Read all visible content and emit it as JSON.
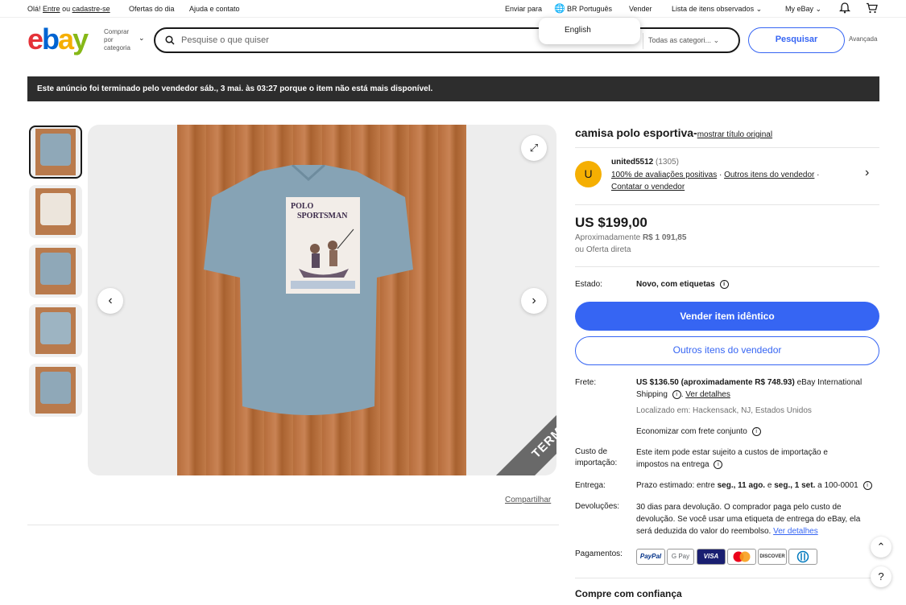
{
  "topbar": {
    "greeting": "Olá!",
    "signin": "Entre",
    "or": "ou",
    "register": "cadastre-se",
    "daily_deals": "Ofertas do dia",
    "help": "Ajuda e contato",
    "ship_to": "Enviar para",
    "language": "BR Português",
    "sell": "Vender",
    "watchlist": "Lista de itens observados",
    "my_ebay": "My eBay",
    "language_option": "English"
  },
  "header": {
    "logo_letters": [
      "e",
      "b",
      "a",
      "y"
    ],
    "logo_colors": [
      "#e53238",
      "#0064d2",
      "#f5af02",
      "#86b817"
    ],
    "shop_by_category": "Comprar por categoria",
    "search_placeholder": "Pesquise o que quiser",
    "category_select": "Todas as categori...",
    "search_button": "Pesquisar",
    "advanced": "Avançada"
  },
  "banner": {
    "text": "Este anúncio foi terminado pelo vendedor sáb., 3 mai. às 03:27 porque o item não está mais disponível."
  },
  "gallery": {
    "ended_ribbon": "TERMINADO",
    "graphic_text_1": "POLO",
    "graphic_text_2": "SPORTSMAN",
    "share": "Compartilhar"
  },
  "item": {
    "title": "camisa polo esportiva-",
    "show_original": "mostrar título original",
    "seller_initial": "U",
    "seller_name": "united5512",
    "seller_score": "(1305)",
    "feedback": "100% de avaliações positivas",
    "other_items_link": "Outros itens do vendedor",
    "contact_seller": "Contatar o vendedor",
    "price": "US $199,00",
    "approx_label": "Aproximadamente",
    "approx_value": "R$ 1 091,85",
    "or_offer": "ou Oferta direta",
    "condition_label": "Estado:",
    "condition_value": "Novo, com etiquetas",
    "sell_similar": "Vender item idêntico",
    "seller_other_items": "Outros itens do vendedor",
    "shipping_label": "Frete:",
    "shipping_value": "US $136.50 (aproximadamente R$ 748.93)",
    "shipping_service": "eBay International Shipping",
    "see_details": "Ver detalhes",
    "located_in": "Localizado em: Hackensack, NJ, Estados Unidos",
    "combined_shipping": "Economizar com frete conjunto",
    "import_label": "Custo de importação:",
    "import_value": "Este item pode estar sujeito a custos de importação e impostos na entrega",
    "delivery_label": "Entrega:",
    "delivery_prefix": "Prazo estimado: entre",
    "delivery_from": "seg., 11 ago.",
    "delivery_and": "e",
    "delivery_to": "seg., 1 set.",
    "delivery_suffix": "a 100-0001",
    "returns_label": "Devoluções:",
    "returns_value": "30 dias para devolução. O comprador paga pelo custo de devolução. Se você usar uma etiqueta de entrega do eBay, ela será deduzida do valor do reembolso.",
    "returns_details": "Ver detalhes",
    "payments_label": "Pagamentos:",
    "payments": [
      "PayPal",
      "G Pay",
      "VISA",
      "MC",
      "DISCOVER",
      "Diners"
    ],
    "buy_with_confidence": "Compre com confiança"
  },
  "accent": "#3665f3"
}
